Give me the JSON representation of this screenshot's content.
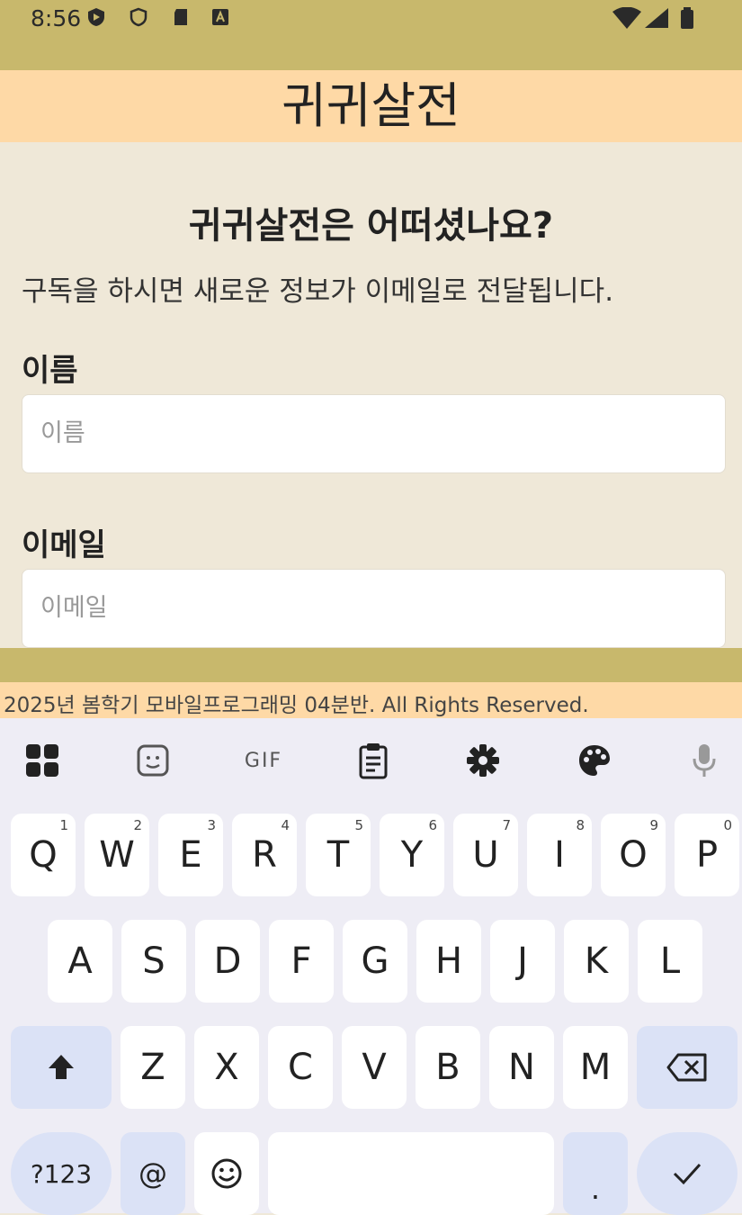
{
  "status_bar": {
    "time": "8:56"
  },
  "header": {
    "title": "귀귀살전"
  },
  "main": {
    "heading": "귀귀살전은 어떠셨나요?",
    "description": "구독을 하시면 새로운 정보가 이메일로 전달됩니다.",
    "name_label": "이름",
    "name_placeholder": "이름",
    "email_label": "이메일",
    "email_placeholder": "이메일"
  },
  "footer": {
    "text": "2025년 봄학기 모바일프로그래밍 04분반. All Rights Reserved."
  },
  "keyboard": {
    "toolbar": {
      "gif": "GIF"
    },
    "row1": [
      {
        "key": "Q",
        "num": "1"
      },
      {
        "key": "W",
        "num": "2"
      },
      {
        "key": "E",
        "num": "3"
      },
      {
        "key": "R",
        "num": "4"
      },
      {
        "key": "T",
        "num": "5"
      },
      {
        "key": "Y",
        "num": "6"
      },
      {
        "key": "U",
        "num": "7"
      },
      {
        "key": "I",
        "num": "8"
      },
      {
        "key": "O",
        "num": "9"
      },
      {
        "key": "P",
        "num": "0"
      }
    ],
    "row2": [
      "A",
      "S",
      "D",
      "F",
      "G",
      "H",
      "J",
      "K",
      "L"
    ],
    "row3": [
      "Z",
      "X",
      "C",
      "V",
      "B",
      "N",
      "M"
    ],
    "symbols_key": "?123",
    "at_key": "@",
    "period_key": "."
  }
}
